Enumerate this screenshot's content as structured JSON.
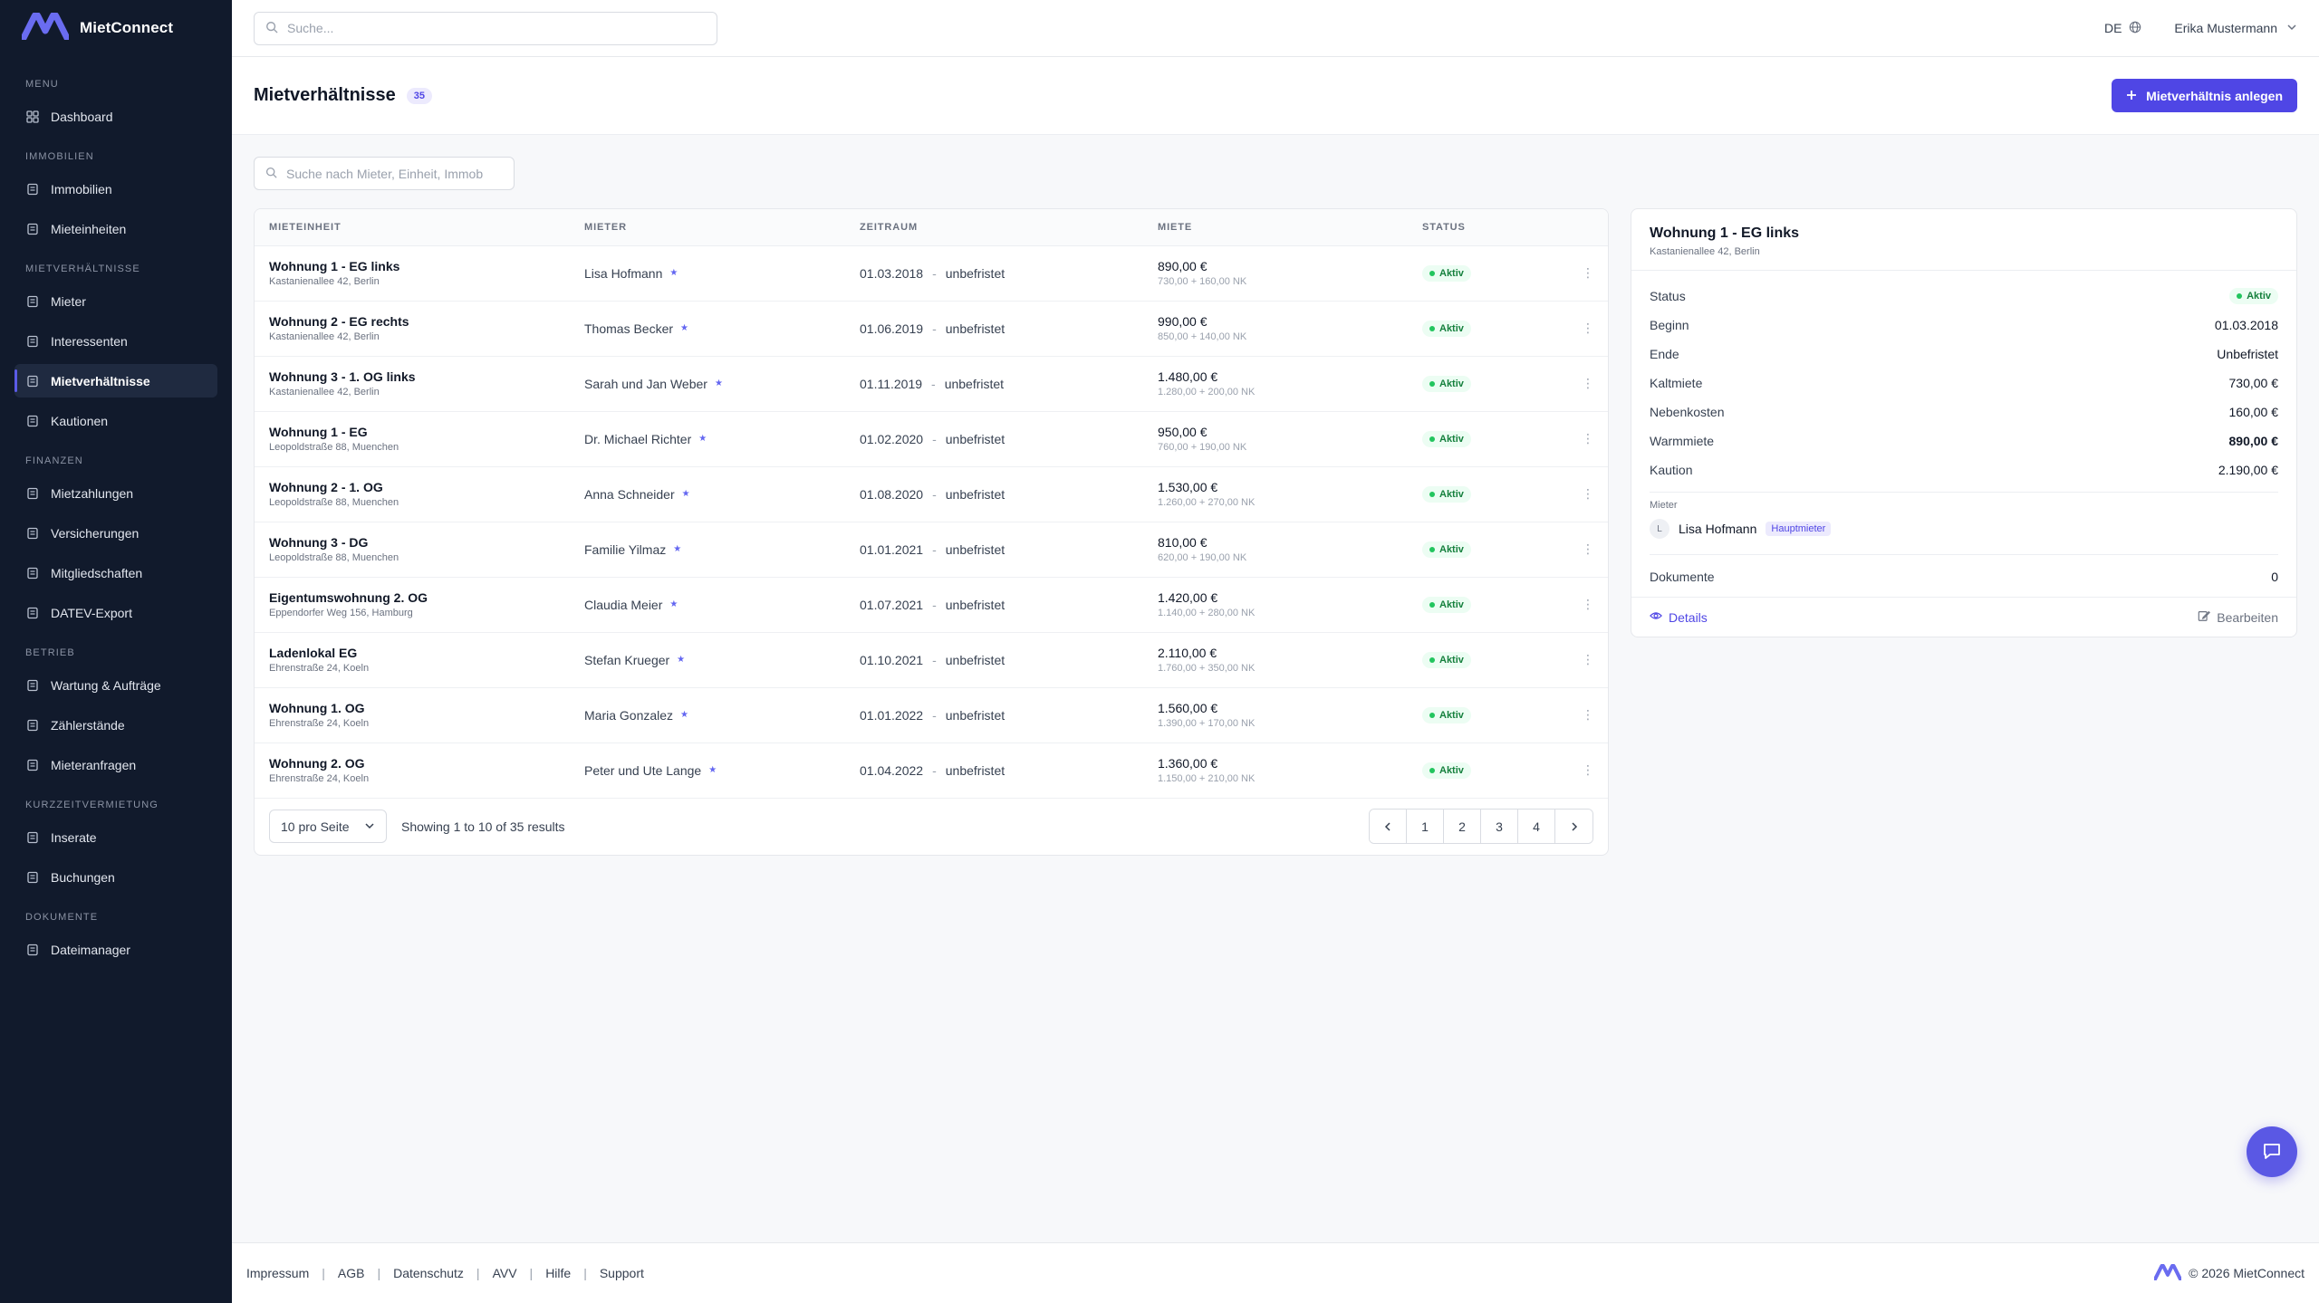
{
  "brand": {
    "name": "MietConnect"
  },
  "sidebar": {
    "sections": [
      {
        "title": "MENU",
        "items": [
          {
            "label": "Dashboard",
            "icon": "grid-icon"
          }
        ]
      },
      {
        "title": "IMMOBILIEN",
        "items": [
          {
            "label": "Immobilien",
            "icon": "building-icon"
          },
          {
            "label": "Mieteinheiten",
            "icon": "apartment-icon"
          }
        ]
      },
      {
        "title": "MIETVERHÄLTNISSE",
        "items": [
          {
            "label": "Mieter",
            "icon": "users-icon"
          },
          {
            "label": "Interessenten",
            "icon": "user-search-icon"
          },
          {
            "label": "Mietverhältnisse",
            "icon": "document-icon",
            "active": true
          },
          {
            "label": "Kautionen",
            "icon": "shield-icon"
          }
        ]
      },
      {
        "title": "FINANZEN",
        "items": [
          {
            "label": "Mietzahlungen",
            "icon": "cash-icon"
          },
          {
            "label": "Versicherungen",
            "icon": "shield-check-icon"
          },
          {
            "label": "Mitgliedschaften",
            "icon": "id-card-icon"
          },
          {
            "label": "DATEV-Export",
            "icon": "file-export-icon"
          }
        ]
      },
      {
        "title": "BETRIEB",
        "items": [
          {
            "label": "Wartung & Aufträge",
            "icon": "wrench-icon"
          },
          {
            "label": "Zählerstände",
            "icon": "meter-icon"
          },
          {
            "label": "Mieteranfragen",
            "icon": "chat-icon"
          }
        ]
      },
      {
        "title": "KURZZEITVERMIETUNG",
        "items": [
          {
            "label": "Inserate",
            "icon": "listing-icon"
          },
          {
            "label": "Buchungen",
            "icon": "calendar-icon"
          }
        ]
      },
      {
        "title": "DOKUMENTE",
        "items": [
          {
            "label": "Dateimanager",
            "icon": "folder-icon"
          }
        ]
      }
    ]
  },
  "topbar": {
    "search_placeholder": "Suche...",
    "lang": "DE",
    "user": "Erika Mustermann"
  },
  "page": {
    "title": "Mietverhältnisse",
    "count": "35",
    "create_label": "Mietverhältnis anlegen",
    "filter_placeholder": "Suche nach Mieter, Einheit, Immob"
  },
  "table": {
    "headers": [
      "MIETEINHEIT",
      "MIETER",
      "ZEITRAUM",
      "MIETE",
      "STATUS"
    ],
    "rows": [
      {
        "unit": "Wohnung 1 - EG links",
        "addr": "Kastanienallee 42, Berlin",
        "tenant": "Lisa Hofmann",
        "start": "01.03.2018",
        "end": "unbefristet",
        "rent": "890,00 €",
        "rent_sub": "730,00 + 160,00 NK",
        "status": "Aktiv"
      },
      {
        "unit": "Wohnung 2 - EG rechts",
        "addr": "Kastanienallee 42, Berlin",
        "tenant": "Thomas Becker",
        "start": "01.06.2019",
        "end": "unbefristet",
        "rent": "990,00 €",
        "rent_sub": "850,00 + 140,00 NK",
        "status": "Aktiv"
      },
      {
        "unit": "Wohnung 3 - 1. OG links",
        "addr": "Kastanienallee 42, Berlin",
        "tenant": "Sarah und Jan Weber",
        "start": "01.11.2019",
        "end": "unbefristet",
        "rent": "1.480,00 €",
        "rent_sub": "1.280,00 + 200,00 NK",
        "status": "Aktiv"
      },
      {
        "unit": "Wohnung 1 - EG",
        "addr": "Leopoldstraße 88, Muenchen",
        "tenant": "Dr. Michael Richter",
        "start": "01.02.2020",
        "end": "unbefristet",
        "rent": "950,00 €",
        "rent_sub": "760,00 + 190,00 NK",
        "status": "Aktiv"
      },
      {
        "unit": "Wohnung 2 - 1. OG",
        "addr": "Leopoldstraße 88, Muenchen",
        "tenant": "Anna Schneider",
        "start": "01.08.2020",
        "end": "unbefristet",
        "rent": "1.530,00 €",
        "rent_sub": "1.260,00 + 270,00 NK",
        "status": "Aktiv"
      },
      {
        "unit": "Wohnung 3 - DG",
        "addr": "Leopoldstraße 88, Muenchen",
        "tenant": "Familie Yilmaz",
        "start": "01.01.2021",
        "end": "unbefristet",
        "rent": "810,00 €",
        "rent_sub": "620,00 + 190,00 NK",
        "status": "Aktiv"
      },
      {
        "unit": "Eigentumswohnung 2. OG",
        "addr": "Eppendorfer Weg 156, Hamburg",
        "tenant": "Claudia Meier",
        "start": "01.07.2021",
        "end": "unbefristet",
        "rent": "1.420,00 €",
        "rent_sub": "1.140,00 + 280,00 NK",
        "status": "Aktiv"
      },
      {
        "unit": "Ladenlokal EG",
        "addr": "Ehrenstraße 24, Koeln",
        "tenant": "Stefan Krueger",
        "start": "01.10.2021",
        "end": "unbefristet",
        "rent": "2.110,00 €",
        "rent_sub": "1.760,00 + 350,00 NK",
        "status": "Aktiv"
      },
      {
        "unit": "Wohnung 1. OG",
        "addr": "Ehrenstraße 24, Koeln",
        "tenant": "Maria Gonzalez",
        "start": "01.01.2022",
        "end": "unbefristet",
        "rent": "1.560,00 €",
        "rent_sub": "1.390,00 + 170,00 NK",
        "status": "Aktiv"
      },
      {
        "unit": "Wohnung 2. OG",
        "addr": "Ehrenstraße 24, Koeln",
        "tenant": "Peter und Ute Lange",
        "start": "01.04.2022",
        "end": "unbefristet",
        "rent": "1.360,00 €",
        "rent_sub": "1.150,00 + 210,00 NK",
        "status": "Aktiv"
      }
    ]
  },
  "pagination": {
    "per_page": "10 pro Seite",
    "results": "Showing 1 to 10 of 35 results",
    "pages": [
      "1",
      "2",
      "3",
      "4"
    ]
  },
  "detail": {
    "title": "Wohnung 1 - EG links",
    "addr": "Kastanienallee 42, Berlin",
    "status_label": "Status",
    "status_value": "Aktiv",
    "fields": [
      {
        "k": "Beginn",
        "v": "01.03.2018",
        "bold": false
      },
      {
        "k": "Ende",
        "v": "Unbefristet",
        "bold": false
      },
      {
        "k": "Kaltmiete",
        "v": "730,00 €",
        "bold": false
      },
      {
        "k": "Nebenkosten",
        "v": "160,00 €",
        "bold": false
      },
      {
        "k": "Warmmiete",
        "v": "890,00 €",
        "bold": true
      },
      {
        "k": "Kaution",
        "v": "2.190,00 €",
        "bold": false
      }
    ],
    "mieter_label": "Mieter",
    "mieter_initial": "L",
    "mieter_name": "Lisa Hofmann",
    "mieter_tag": "Hauptmieter",
    "docs_label": "Dokumente",
    "docs_count": "0",
    "details_link": "Details",
    "edit_link": "Bearbeiten"
  },
  "footer": {
    "links": [
      "Impressum",
      "AGB",
      "Datenschutz",
      "AVV",
      "Hilfe",
      "Support"
    ],
    "copyright": "© 2026 MietConnect"
  },
  "colors": {
    "accent": "#4f46e5",
    "sidebar_bg": "#111a2c",
    "status_green": "#15803d"
  }
}
